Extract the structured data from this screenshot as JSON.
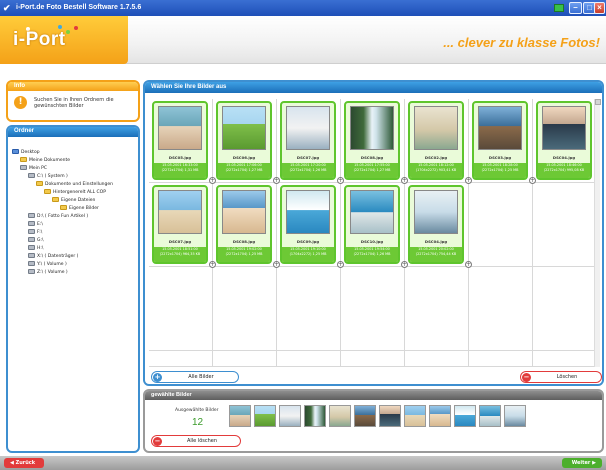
{
  "window": {
    "title": "i-Port.de Foto Bestell Software 1.7.5.6"
  },
  "header": {
    "logo": "i-Port",
    "slogan": "... clever zu klasse Fotos!"
  },
  "info": {
    "title": "Info",
    "text": "Suchen Sie in Ihren Ordnern die gewünschten Bilder"
  },
  "folders": {
    "title": "Ordner",
    "items": [
      {
        "label": "Desktop",
        "type": "desktop",
        "level": 0
      },
      {
        "label": "Meine Dokumente",
        "type": "folder",
        "level": 1
      },
      {
        "label": "Mein PC",
        "type": "drive",
        "level": 1
      },
      {
        "label": "C:\\ ( System )",
        "type": "drive",
        "level": 2
      },
      {
        "label": "Dokumente und Einstellungen",
        "type": "folder",
        "level": 3
      },
      {
        "label": "Hintergenerelt ALL COP",
        "type": "folder",
        "level": 4
      },
      {
        "label": "Eigene Dateien",
        "type": "folder",
        "level": 5
      },
      {
        "label": "Eigene Bilder",
        "type": "folder",
        "level": 6
      },
      {
        "label": "D:\\ ( Fotto Fun Artikel )",
        "type": "drive",
        "level": 2
      },
      {
        "label": "E:\\",
        "type": "drive",
        "level": 2
      },
      {
        "label": "F:\\",
        "type": "drive",
        "level": 2
      },
      {
        "label": "G:\\",
        "type": "drive",
        "level": 2
      },
      {
        "label": "H:\\",
        "type": "drive",
        "level": 2
      },
      {
        "label": "X:\\ ( Datenträger )",
        "type": "drive",
        "level": 2
      },
      {
        "label": "Y:\\ ( Volume )",
        "type": "drive",
        "level": 2
      },
      {
        "label": "Z:\\ ( Volume )",
        "type": "drive",
        "level": 2
      }
    ]
  },
  "gallery": {
    "title": "Wählen Sie Ihre Bilder aus",
    "photos": [
      {
        "name": "DSC05.jpg",
        "date": "15.05.2001 16:33:00",
        "info": "(2272x1704) 1,31 MB",
        "theme": "rest"
      },
      {
        "name": "DSC06.jpg",
        "date": "15.05.2001 17:06:00",
        "info": "(2272x1704) 1,27 MB",
        "theme": "jump"
      },
      {
        "name": "DSC07.jpg",
        "date": "15.05.2001 17:20:00",
        "info": "(2272x1704) 1,26 MB",
        "theme": "hair"
      },
      {
        "name": "DSC08.jpg",
        "date": "15.05.2001 17:55:00",
        "info": "(2272x1704) 1,27 MB",
        "theme": "falls"
      },
      {
        "name": "DSC02.jpg",
        "date": "15.05.2001 18:12:00",
        "info": "(1704x2272) 903,41 KB",
        "theme": "pose"
      },
      {
        "name": "DSC03.jpg",
        "date": "15.05.2001 18:28:00",
        "info": "(2272x1704) 1,25 MB",
        "theme": "cliff"
      },
      {
        "name": "DSC04.jpg",
        "date": "15.05.2001 18:46:00",
        "info": "(2272x1704) 995,08 KB",
        "theme": "yoga"
      },
      {
        "name": "DSC07.jpg",
        "date": "15.05.2001 18:51:00",
        "info": "(2272x1704) 964,35 KB",
        "theme": "beach"
      },
      {
        "name": "DSC08.jpg",
        "date": "15.05.2001 19:02:00",
        "info": "(2272x1704) 1,25 MB",
        "theme": "beach2"
      },
      {
        "name": "DSC09.jpg",
        "date": "15.05.2001 19:10:00",
        "info": "(1704x2272) 1,25 MB",
        "theme": "sit"
      },
      {
        "name": "DSC10.jpg",
        "date": "15.05.2001 19:54:00",
        "info": "(2272x1704) 1,26 MB",
        "theme": "pool"
      },
      {
        "name": "DSC04.jpg",
        "date": "15.05.2001 20:02:00",
        "info": "(2272x1704) 754,44 KB",
        "theme": "kid"
      }
    ],
    "btn_all": "Alle Bilder",
    "btn_delete": "Löschen"
  },
  "selected": {
    "title": "gewählte Bilder",
    "count_label": "Ausgewählte Bilder",
    "count": "12",
    "btn_delete_all": "Alle löschen"
  },
  "footer": {
    "back": "Zurück",
    "next": "Weiter"
  },
  "colors": {
    "accent_orange": "#f4a118",
    "accent_blue": "#3e8fd0",
    "accent_green": "#5fc52d",
    "accent_red": "#e23b3b"
  }
}
